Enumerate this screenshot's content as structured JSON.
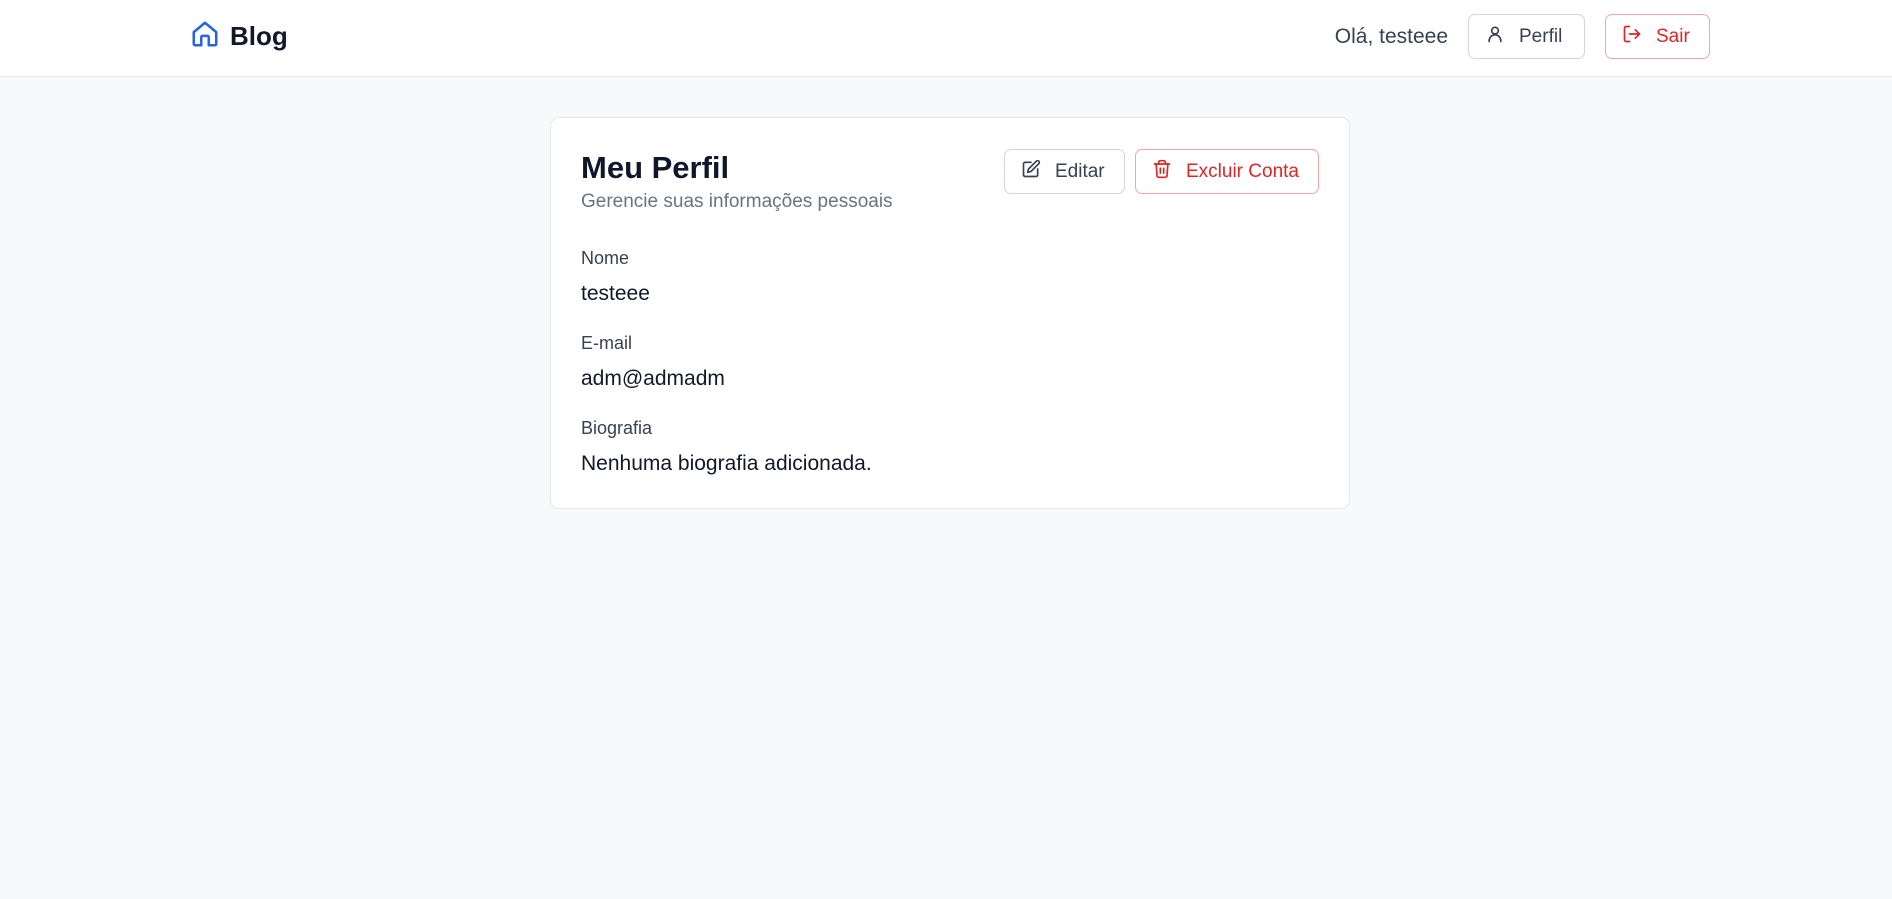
{
  "header": {
    "brand": "Blog",
    "greeting": "Olá, testeee",
    "profile_label": "Perfil",
    "logout_label": "Sair"
  },
  "profile": {
    "title": "Meu Perfil",
    "subtitle": "Gerencie suas informações pessoais",
    "edit_label": "Editar",
    "delete_label": "Excluir Conta",
    "fields": [
      {
        "label": "Nome",
        "value": "testeee"
      },
      {
        "label": "E-mail",
        "value": "adm@admadm"
      },
      {
        "label": "Biografia",
        "value": "Nenhuma biografia adicionada."
      }
    ]
  },
  "icons": {
    "brand": "home-icon",
    "profile": "user-icon",
    "logout": "logout-icon",
    "edit": "edit-icon",
    "delete": "trash-icon"
  },
  "colors": {
    "accent": "#2563eb",
    "danger": "#dc2626",
    "background": "#f8f9fb"
  }
}
